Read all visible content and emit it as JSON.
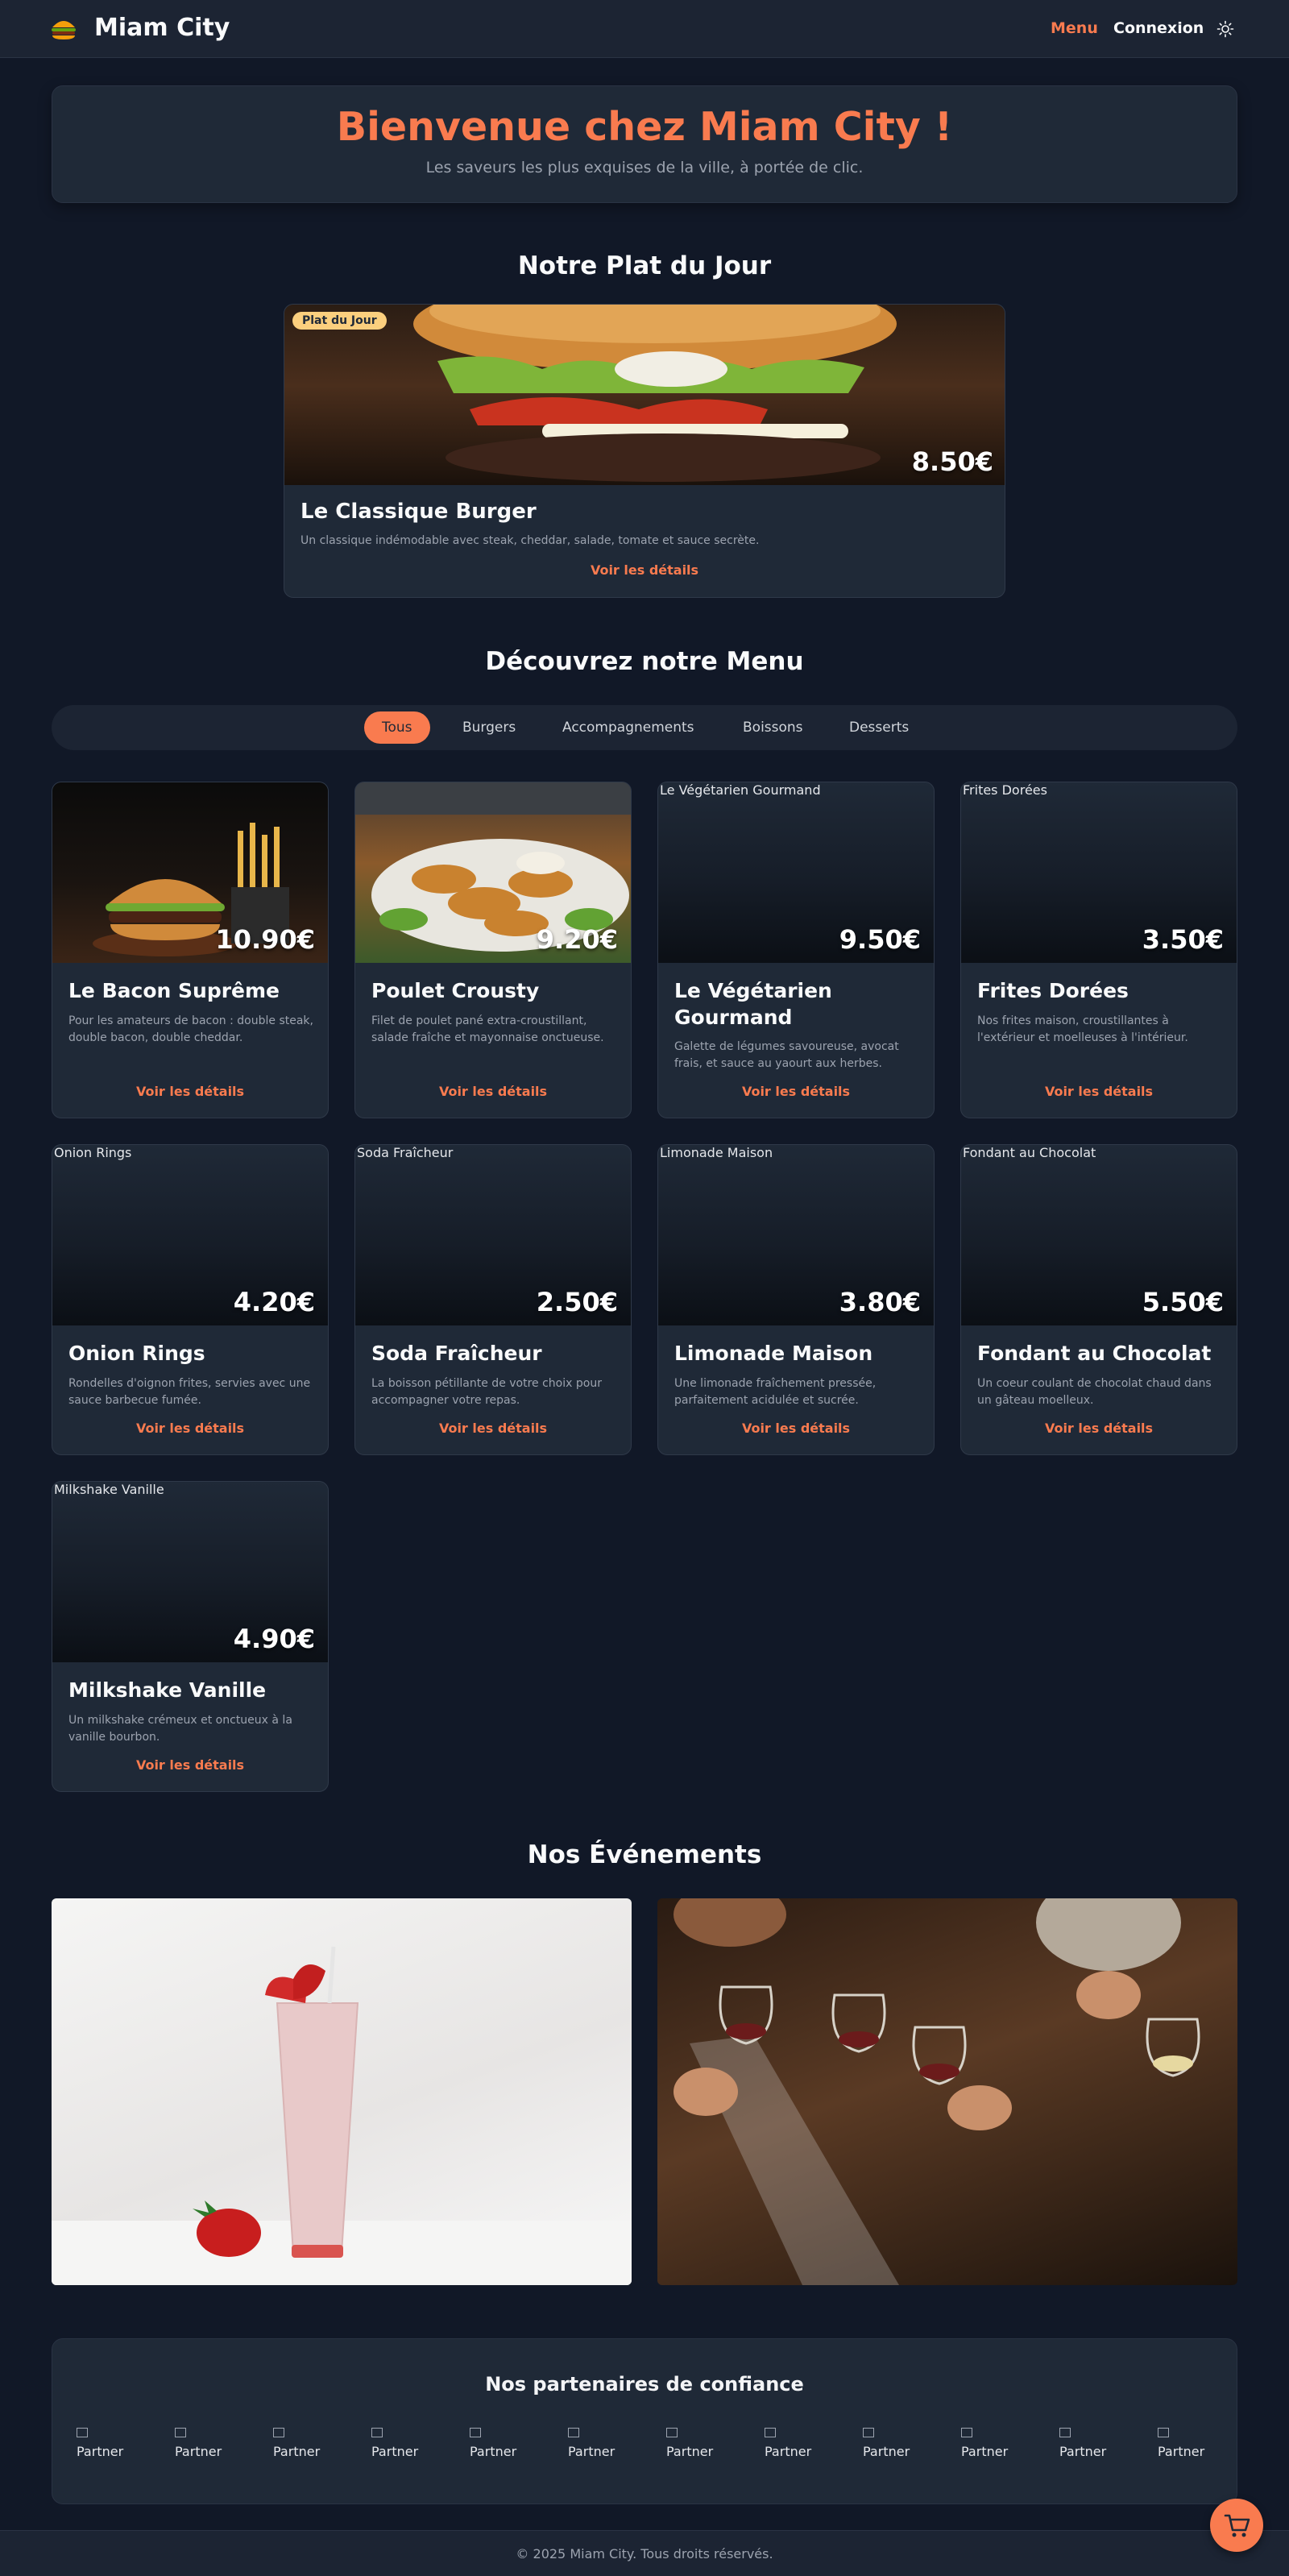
{
  "header": {
    "brand": "Miam City",
    "logo_icon": "burger-icon",
    "nav": {
      "menu": "Menu",
      "login": "Connexion"
    },
    "theme_icon": "sun-icon"
  },
  "hero": {
    "title": "Bienvenue chez Miam City !",
    "subtitle": "Les saveurs les plus exquises de la ville, à portée de clic."
  },
  "dish_of_day": {
    "section_title": "Notre Plat du Jour",
    "badge": "Plat du Jour",
    "price": "8.50€",
    "name": "Le Classique Burger",
    "description": "Un classique indémodable avec steak, cheddar, salade, tomate et sauce secrète.",
    "link": "Voir les détails"
  },
  "menu": {
    "section_title": "Découvrez notre Menu",
    "filters": [
      "Tous",
      "Burgers",
      "Accompagnements",
      "Boissons",
      "Desserts"
    ],
    "active_filter": "Tous",
    "items": [
      {
        "name": "Le Bacon Suprême",
        "price": "10.90€",
        "alt": "",
        "description": "Pour les amateurs de bacon : double steak, double bacon, double cheddar.",
        "link": "Voir les détails"
      },
      {
        "name": "Poulet Crousty",
        "price": "9.20€",
        "alt": "",
        "description": "Filet de poulet pané extra-croustillant, salade fraîche et mayonnaise onctueuse.",
        "link": "Voir les détails"
      },
      {
        "name": "Le Végétarien Gourmand",
        "price": "9.50€",
        "alt": "Le Végétarien Gourmand",
        "description": "Galette de légumes savoureuse, avocat frais, et sauce au yaourt aux herbes.",
        "link": "Voir les détails"
      },
      {
        "name": "Frites Dorées",
        "price": "3.50€",
        "alt": "Frites Dorées",
        "description": "Nos frites maison, croustillantes à l'extérieur et moelleuses à l'intérieur.",
        "link": "Voir les détails"
      },
      {
        "name": "Onion Rings",
        "price": "4.20€",
        "alt": "Onion Rings",
        "description": "Rondelles d'oignon frites, servies avec une sauce barbecue fumée.",
        "link": "Voir les détails"
      },
      {
        "name": "Soda Fraîcheur",
        "price": "2.50€",
        "alt": "Soda Fraîcheur",
        "description": "La boisson pétillante de votre choix pour accompagner votre repas.",
        "link": "Voir les détails"
      },
      {
        "name": "Limonade Maison",
        "price": "3.80€",
        "alt": "Limonade Maison",
        "description": "Une limonade fraîchement pressée, parfaitement acidulée et sucrée.",
        "link": "Voir les détails"
      },
      {
        "name": "Fondant au Chocolat",
        "price": "5.50€",
        "alt": "Fondant au Chocolat",
        "description": "Un coeur coulant de chocolat chaud dans un gâteau moelleux.",
        "link": "Voir les détails"
      },
      {
        "name": "Milkshake Vanille",
        "price": "4.90€",
        "alt": "Milkshake Vanille",
        "description": "Un milkshake crémeux et onctueux à la vanille bourbon.",
        "link": "Voir les détails"
      }
    ]
  },
  "events": {
    "section_title": "Nos Événements"
  },
  "partners": {
    "title": "Nos partenaires de confiance",
    "items": [
      "Partner",
      "Partner",
      "Partner",
      "Partner",
      "Partner",
      "Partner",
      "Partner",
      "Partner",
      "Partner",
      "Partner",
      "Partner",
      "Partner"
    ]
  },
  "footer": {
    "copyright": "© 2025 Miam City. Tous droits réservés."
  },
  "cart_icon": "cart-icon",
  "colors": {
    "accent": "#f97b4f",
    "background": "#111827",
    "card": "#1f2937",
    "badge": "#fbcf7e"
  }
}
